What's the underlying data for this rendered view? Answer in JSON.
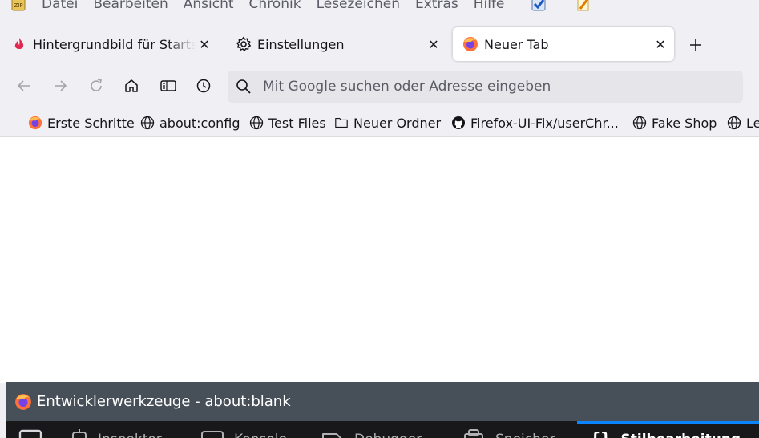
{
  "menubar": {
    "items": [
      "Datei",
      "Bearbeiten",
      "Ansicht",
      "Chronik",
      "Lesezeichen",
      "Extras",
      "Hilfe"
    ],
    "zip_label": "ZIP"
  },
  "tabs": [
    {
      "label": "Hintergrundbild für Startseite",
      "icon": "flame-icon",
      "selected": false
    },
    {
      "label": "Einstellungen",
      "icon": "gear-icon",
      "selected": false
    },
    {
      "label": "Neuer Tab",
      "icon": "firefox-icon",
      "selected": true
    }
  ],
  "urlbar": {
    "placeholder": "Mit Google suchen oder Adresse eingeben"
  },
  "bookmarks": [
    {
      "label": "Erste Schritte",
      "icon": "firefox-icon"
    },
    {
      "label": "about:config",
      "icon": "globe-icon"
    },
    {
      "label": "Test Files",
      "icon": "globe-icon"
    },
    {
      "label": "Neuer Ordner",
      "icon": "folder-icon"
    },
    {
      "label": "Firefox-UI-Fix/userChr...",
      "icon": "github-icon"
    },
    {
      "label": "Fake Shop",
      "icon": "globe-icon"
    },
    {
      "label": "Le",
      "icon": "globe-icon"
    }
  ],
  "devtools": {
    "title": "Entwicklerwerkzeuge - about:blank",
    "tabs": [
      {
        "label": "Inspektor"
      },
      {
        "label": "Konsole"
      },
      {
        "label": "Debugger"
      },
      {
        "label": "Speicher"
      },
      {
        "label": "Stilbearbeitung",
        "selected": true
      }
    ]
  },
  "colors": {
    "accent": "#0a84ff",
    "toolbar_bg": "#f0f0f4",
    "devtools_title_bg": "#474f59",
    "devtools_toolbar_bg": "#18181b"
  }
}
